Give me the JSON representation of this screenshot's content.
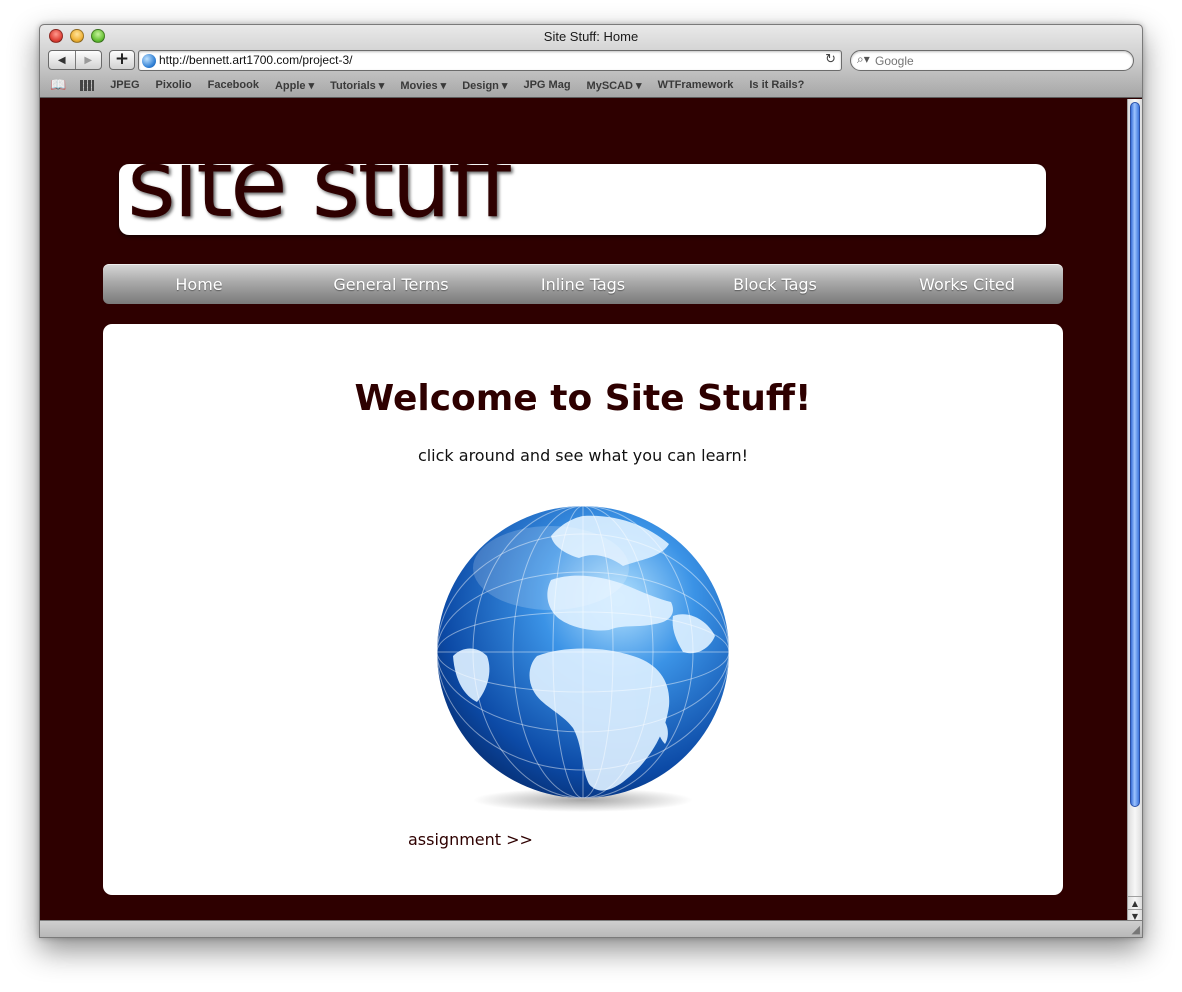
{
  "browser": {
    "window_title": "Site Stuff: Home",
    "url": "http://bennett.art1700.com/project-3/",
    "search_placeholder": "Google",
    "bookmarks": [
      {
        "label": "JPEG"
      },
      {
        "label": "Pixolio"
      },
      {
        "label": "Facebook"
      },
      {
        "label": "Apple ▾"
      },
      {
        "label": "Tutorials ▾"
      },
      {
        "label": "Movies ▾"
      },
      {
        "label": "Design ▾"
      },
      {
        "label": "JPG Mag"
      },
      {
        "label": "MySCAD ▾"
      },
      {
        "label": "WTFramework"
      },
      {
        "label": "Is it Rails?"
      }
    ]
  },
  "site": {
    "logo": "site stuff",
    "nav": [
      "Home",
      "General Terms",
      "Inline Tags",
      "Block Tags",
      "Works Cited"
    ],
    "heading": "Welcome to Site Stuff!",
    "subtitle": "click around and see what you can learn!",
    "assignment_link": "assignment >>"
  },
  "colors": {
    "page_background": "#2e0000",
    "heading": "#2e0000",
    "nav_text": "#ffffff",
    "content_background": "#ffffff"
  },
  "icons": {
    "back": "back-arrow-icon",
    "forward": "forward-arrow-icon",
    "add": "plus-icon",
    "site_favicon": "globe-icon",
    "reload": "reload-icon",
    "search": "magnifier-icon",
    "bookmarks": "book-icon",
    "top_sites": "grid-icon"
  }
}
